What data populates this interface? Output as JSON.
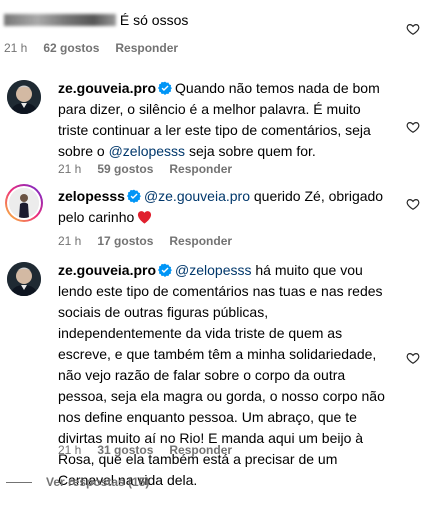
{
  "top_comment": {
    "text": "É só ossos",
    "time": "21 h",
    "likes": "62 gostos",
    "reply": "Responder"
  },
  "comments": [
    {
      "username": "ze.gouveia.pro",
      "text_1": "Quando não temos nada de bom para dizer, o silêncio é a melhor palavra. É muito triste continuar a ler este tipo de comentários, seja sobre o ",
      "mention": "@zelopesss",
      "text_2": " seja sobre quem for.",
      "time": "21 h",
      "likes": "59 gostos",
      "reply": "Responder"
    },
    {
      "username": "zelopesss",
      "mention": "@ze.gouveia.pro",
      "text_1": " querido Zé, obrigado pelo carinho",
      "time": "21 h",
      "likes": "17 gostos",
      "reply": "Responder"
    },
    {
      "username": "ze.gouveia.pro",
      "mention": "@zelopesss",
      "text_1": " há muito que vou lendo este tipo de comentários nas tuas e nas redes sociais de outras figuras públicas, independentemente da vida triste de quem as escreve, e que também têm a minha solidariedade, não vejo razão de falar sobre o corpo da outra pessoa, seja ela magra ou gorda, o nosso corpo não nos define enquanto pessoa. Um abraço, que te divirtas muito aí no Rio! E manda aqui um beijo à Rosa, que ela também está a precisar de um Carnaval na vida dela.",
      "time": "21 h",
      "likes": "31 gostos",
      "reply": "Responder"
    }
  ],
  "view_replies": "Ver respostas (15)",
  "colors": {
    "mention": "#00376b",
    "meta": "#737373",
    "verified": "#0095f6",
    "heart": "#ed4956"
  },
  "icons": [
    "heart-outline-icon",
    "verified-badge-icon",
    "red-heart-emoji"
  ]
}
